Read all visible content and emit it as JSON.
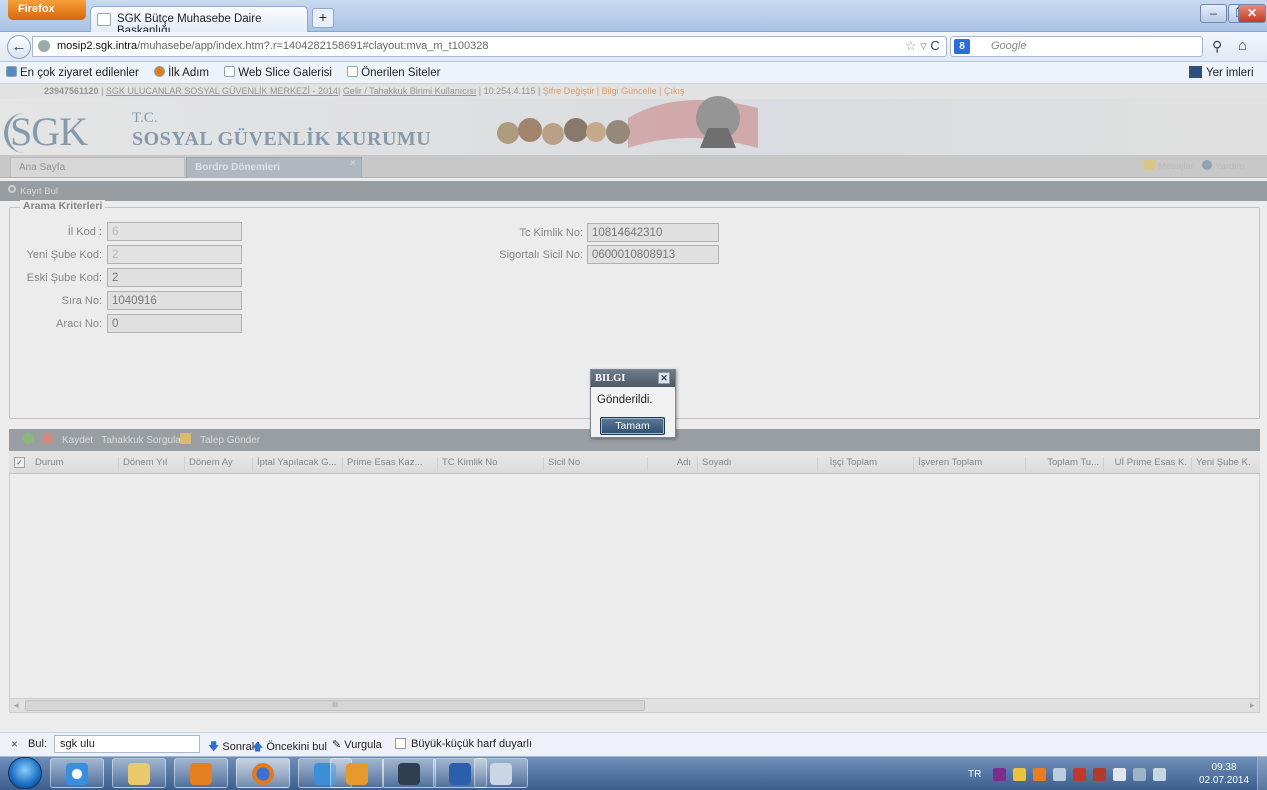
{
  "browser": {
    "menu_button": "Firefox",
    "tab_title": "SGK Bütçe Muhasebe Daire Başkanlığı",
    "new_tab": "+",
    "url_host": "mosip2.sgk.intra",
    "url_path": "/muhasebe/app/index.htm?.r=1404282158691#clayout:mva_m_t100328",
    "search_placeholder": "Google",
    "bookmarks": [
      "En çok ziyaret edilenler",
      "İlk Adım",
      "Web Slice Galerisi",
      "Önerilen Siteler"
    ],
    "bookmarks_menu": "Yer imleri"
  },
  "app": {
    "infobar_user": "23947561120",
    "infobar_unit": "SGK ULUCANLAR SOSYAL GÜVENLİK MERKEZİ - 2014",
    "infobar_role": "Gelir / Tahakkuk Birimi Kullanıcısı",
    "infobar_ip": "10.254.4.115",
    "infobar_links": "Şifre Değiştir | Bilgi Güncelle | Çıkış",
    "logo_abbr": "SGK",
    "logo_tc": "T.C.",
    "logo_name": "SOSYAL GÜVENLİK KURUMU",
    "tabs": [
      "Ana Sayfa",
      "Bordro Dönemleri"
    ],
    "tab_close": "×",
    "help_links": [
      "Mesajlar",
      "Yardım"
    ],
    "toolbar_search": "Kayıt Bul",
    "criteria_legend": "Arama Kriterleri",
    "fields_left": [
      {
        "label": "İl Kod :",
        "value": "6"
      },
      {
        "label": "Yeni Şube Kod:",
        "value": "2"
      },
      {
        "label": "Eski Şube Kod:",
        "value": "2"
      },
      {
        "label": "Sıra No:",
        "value": "1040916"
      },
      {
        "label": "Aracı No:",
        "value": "0"
      }
    ],
    "fields_right": [
      {
        "label": "Tc Kimlik No:",
        "value": "10814642310"
      },
      {
        "label": "Sigortalı Sicil No:",
        "value": "0600010808913"
      }
    ],
    "grid_toolbar": [
      "Kaydet",
      "Tahakkuk Sorgula",
      "Talep Gönder"
    ],
    "grid_columns": [
      "Durum",
      "Dönem Yıl",
      "Dönem Ay",
      "İptal Yapılacak G...",
      "Prime Esas Kaz...",
      "TC Kimlik No",
      "Sicil No",
      "Adı",
      "Soyadı",
      "İşçi Toplam",
      "İşveren Toplam",
      "Toplam Tu...",
      "Uİ Prime Esas K.",
      "Yeni Şube K."
    ],
    "scroll_grip": "III"
  },
  "modal": {
    "title": "BILGI",
    "close": "✕",
    "message": "Gönderildi.",
    "ok": "Tamam"
  },
  "findbar": {
    "close": "×",
    "label": "Bul:",
    "value": "sgk ulu",
    "next": "Sonraki",
    "prev": "Öncekini bul",
    "highlight": "Vurgula",
    "match_case": "Büyük-küçük harf duyarlı"
  },
  "taskbar": {
    "lang": "TR",
    "time": "09:38",
    "date": "02.07.2014"
  },
  "colors": {
    "titlebar": "#b8cde9",
    "firefox_button": "#e07a1f",
    "app_toolbar": "#9ea4a9",
    "modal_title": "#56626e"
  }
}
